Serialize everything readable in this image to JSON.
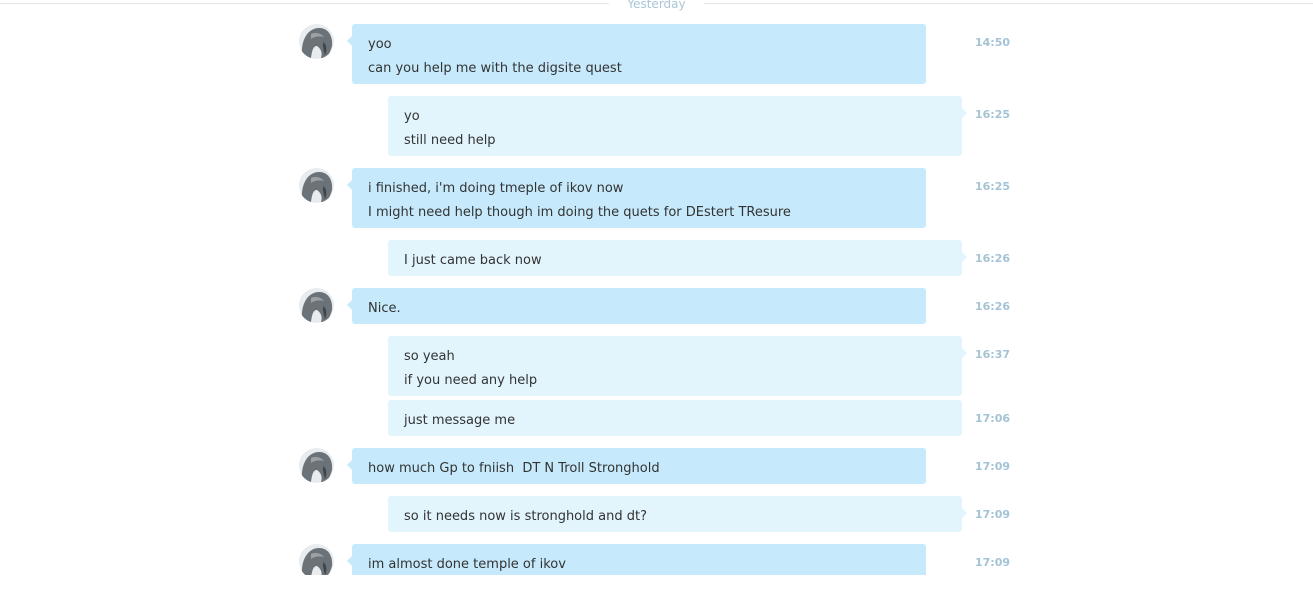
{
  "divider": {
    "label": "Yesterday"
  },
  "messages": [
    {
      "from": "them",
      "time": "14:50",
      "lines": [
        "yoo",
        "can you help me with the digsite quest"
      ]
    },
    {
      "from": "me",
      "time": "16:25",
      "lines": [
        "yo",
        "still need help"
      ]
    },
    {
      "from": "them",
      "time": "16:25",
      "lines": [
        "i finished, i'm doing tmeple of ikov now",
        "I might need help though im doing the quets for DEstert TResure"
      ]
    },
    {
      "from": "me",
      "time": "16:26",
      "lines": [
        "I just came back now"
      ]
    },
    {
      "from": "them",
      "time": "16:26",
      "lines": [
        "Nice."
      ]
    },
    {
      "from": "me",
      "time": "16:37",
      "lines": [
        "so yeah",
        "if you need any help"
      ]
    },
    {
      "from": "me",
      "time": "17:06",
      "lines": [
        "just message me"
      ]
    },
    {
      "from": "them",
      "time": "17:09",
      "lines": [
        "how much Gp to fniish  DT N Troll Stronghold"
      ]
    },
    {
      "from": "me",
      "time": "17:09",
      "lines": [
        "so it needs now is stronghold and dt?"
      ]
    },
    {
      "from": "them",
      "time": "17:09",
      "lines": [
        "im almost done temple of ikov"
      ]
    }
  ]
}
